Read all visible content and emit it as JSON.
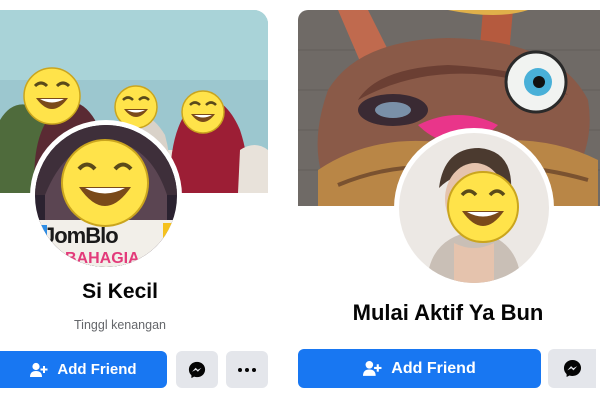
{
  "cards": [
    {
      "name": "Si Kecil",
      "subtitle": "Tinggl kenangan",
      "avatar_banner_text": "JomBlo BAHAGIA",
      "buttons": {
        "add_friend": "Add Friend",
        "messenger_icon": "messenger-icon",
        "more_icon": "more-dots-icon"
      }
    },
    {
      "name": "Mulai Aktif Ya Bun",
      "buttons": {
        "add_friend": "Add Friend",
        "messenger_icon": "messenger-icon"
      }
    }
  ],
  "colors": {
    "primary": "#1877f2",
    "secondary_button": "#e4e6eb",
    "name_text": "#050505",
    "subtitle_text": "#65676b",
    "sticker_yellow": "#ffe34a"
  }
}
